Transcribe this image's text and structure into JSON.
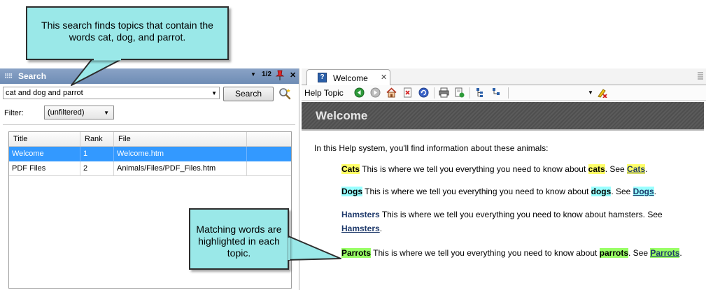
{
  "search_pane": {
    "title": "Search",
    "page_indicator": "1/2",
    "close_glyph": "✕",
    "query_value": "cat and dog and parrot",
    "search_button_label": "Search",
    "filter_label": "Filter:",
    "filter_value": "(unfiltered)",
    "columns": [
      "Title",
      "Rank",
      "File"
    ],
    "rows": [
      {
        "title": "Welcome",
        "rank": "1",
        "file": "Welcome.htm"
      },
      {
        "title": "PDF Files",
        "rank": "2",
        "file": "Animals/Files/PDF_Files.htm"
      }
    ],
    "selected_row": 0
  },
  "topic_pane": {
    "tab_label": "Welcome",
    "tab_close_glyph": "✕",
    "toolbar_label": "Help Topic",
    "topic_title": "Welcome",
    "intro": "In this Help system, you'll find information about these animals:",
    "entries": [
      {
        "term": "Cats",
        "text_before": " This is where we tell you everything you need to know about ",
        "match": "cats",
        "see": ". See ",
        "link": "Cats",
        "end": ".",
        "highlight": "#ffff66"
      },
      {
        "term": "Dogs",
        "text_before": " This is where we tell you everything you need to know about ",
        "match": "dogs",
        "see": ". See ",
        "link": "Dogs",
        "end": ".",
        "highlight": "#99ffff"
      },
      {
        "term": "Hamsters",
        "text_before": " This is where we tell you everything you need to know about hamsters. See ",
        "link": "Hamsters",
        "end": "."
      },
      {
        "term": "Parrots",
        "text_before": " This is where we tell you everything you need to know about ",
        "match": "parrots",
        "see": ". See ",
        "link": "Parrots",
        "end": ".",
        "highlight": "#99ff66"
      }
    ]
  },
  "callouts": {
    "top": "This search finds topics that contain the words cat, dog, and parrot.",
    "bottom": "Matching words are highlighted in each topic."
  },
  "colors": {
    "pane_header": "#7a96bd",
    "selection": "#3399ff",
    "banner": "#555555",
    "callout_fill": "#9ae8e8"
  },
  "icons": [
    "grip-icon",
    "dropdown-arrow-icon",
    "pin-icon",
    "close-icon",
    "magnifier-icon",
    "help-doc-icon",
    "back-icon",
    "forward-icon",
    "home-icon",
    "stop-icon",
    "refresh-icon",
    "print-icon",
    "export-icon",
    "expand-toc-icon",
    "collapse-toc-icon",
    "highlight-eraser-icon"
  ]
}
